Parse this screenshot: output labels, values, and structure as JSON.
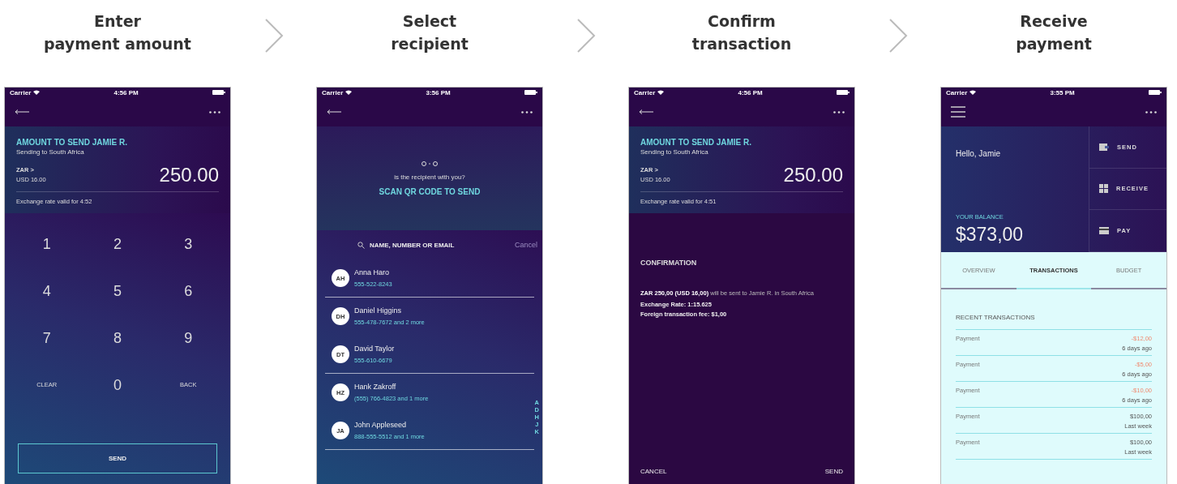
{
  "steps": [
    {
      "title": "Enter\npayment amount",
      "screen": {
        "kind": "keypad",
        "status_bar": {
          "carrier": "Carrier",
          "time": "4:56 PM"
        },
        "header": {
          "title": "AMOUNT TO SEND JAMIE  R.",
          "subtitle": "Sending to South Africa",
          "currency": "ZAR >",
          "converted": "USD 16.00",
          "amount": "250.00",
          "rate_note": "Exchange rate valid for 4:52"
        },
        "keys": [
          "1",
          "2",
          "3",
          "4",
          "5",
          "6",
          "7",
          "8",
          "9",
          "CLEAR",
          "0",
          "BACK"
        ],
        "button": "SEND"
      }
    },
    {
      "title": "Select\nrecipient",
      "screen": {
        "kind": "recipients",
        "status_bar": {
          "carrier": "Carrier",
          "time": "3:56 PM"
        },
        "prompt": "is the recipient with you?",
        "action": "SCAN QR CODE TO SEND",
        "search": {
          "placeholder": "NAME, NUMBER OR EMAIL"
        },
        "cancel": "Cancel",
        "contacts": [
          {
            "initials": "AH",
            "name": "Anna Haro",
            "detail": "555-522-8243",
            "group_end": true
          },
          {
            "initials": "DH",
            "name": "Daniel Higgins",
            "detail": "555-478-7672 and 2 more",
            "group_end": false
          },
          {
            "initials": "DT",
            "name": "David Taylor",
            "detail": "555-610-6679",
            "group_end": true
          },
          {
            "initials": "HZ",
            "name": "Hank Zakroff",
            "detail": "(555) 766-4823 and 1 more",
            "group_end": false
          },
          {
            "initials": "JA",
            "name": "John Appleseed",
            "detail": "888-555-5512 and 1 more",
            "group_end": true
          }
        ],
        "index": [
          "A",
          "D",
          "H",
          "J",
          "K"
        ]
      }
    },
    {
      "title": "Confirm\ntransaction",
      "screen": {
        "kind": "confirmation",
        "status_bar": {
          "carrier": "Carrier",
          "time": "4:56 PM"
        },
        "header": {
          "title": "AMOUNT TO SEND JAMIE  R.",
          "subtitle": "Sending to South Africa",
          "currency": "ZAR >",
          "converted": "USD 16.00",
          "amount": "250.00",
          "rate_note": "Exchange rate valid for 4:51"
        },
        "heading": "CONFIRMATION",
        "message": "**ZAR 250,00 (USD 16,00)** will be sent to Jamie  R. in South Africa",
        "details": [
          "Exchange Rate: 1:15.625",
          "Foreign transaction fee: $1,00"
        ],
        "cancel": "CANCEL",
        "send": "SEND"
      }
    },
    {
      "title": "Receive\npayment",
      "screen": {
        "kind": "dashboard",
        "status_bar": {
          "carrier": "Carrier",
          "time": "3:55 PM"
        },
        "greeting": "Hello, Jamie",
        "balance_label": "YOUR BALANCE",
        "balance": "$373,00",
        "actions": [
          {
            "kind": "send",
            "label": "SEND"
          },
          {
            "kind": "receive",
            "label": "RECEIVE"
          },
          {
            "kind": "pay",
            "label": "PAY"
          }
        ],
        "tabs": [
          {
            "label": "OVERVIEW",
            "selected": false
          },
          {
            "label": "TRANSACTIONS",
            "selected": true
          },
          {
            "label": "BUDGET",
            "selected": false
          }
        ],
        "section": "RECENT TRANSACTIONS",
        "transactions": [
          {
            "label": "Payment",
            "amount": "-$12,00",
            "when": "6 days ago",
            "kind": "debit"
          },
          {
            "label": "Payment",
            "amount": "-$5,00",
            "when": "6 days ago",
            "kind": "debit"
          },
          {
            "label": "Payment",
            "amount": "-$10,00",
            "when": "6 days ago",
            "kind": "debit"
          },
          {
            "label": "Payment",
            "amount": "$100,00",
            "when": "Last week",
            "kind": "credit"
          },
          {
            "label": "Payment",
            "amount": "$100,00",
            "when": "Last week",
            "kind": "credit"
          }
        ]
      }
    }
  ]
}
